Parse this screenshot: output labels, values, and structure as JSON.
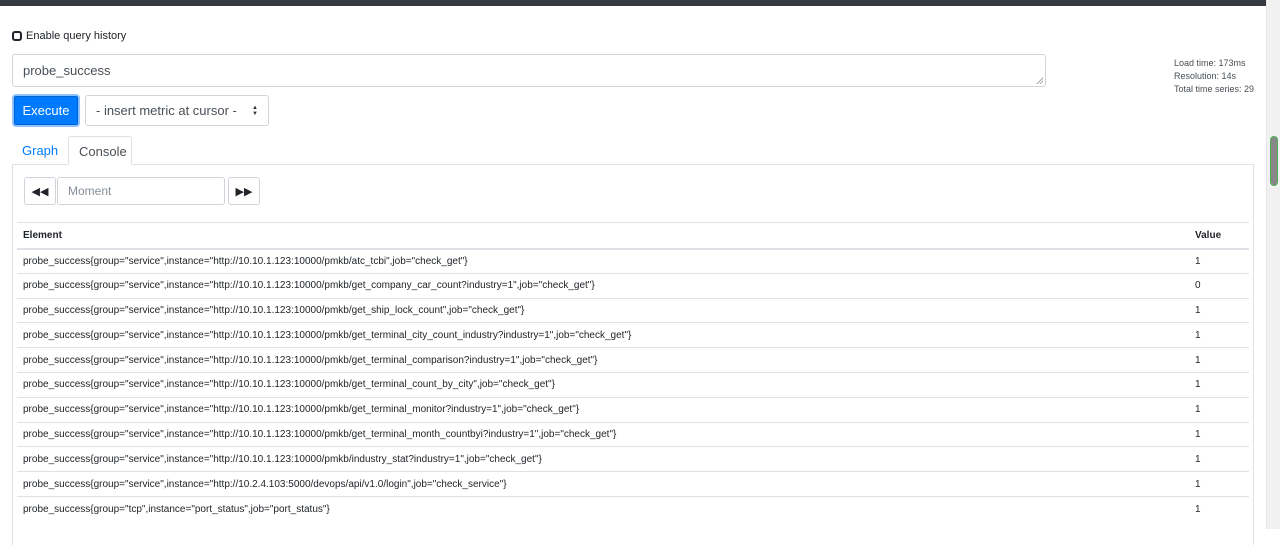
{
  "query_history": {
    "label": "Enable query history",
    "checked": false
  },
  "expression": {
    "value": "probe_success"
  },
  "stats": {
    "load_time": "Load time: 173ms",
    "resolution": "Resolution: 14s",
    "total_series": "Total time series: 29"
  },
  "execute_label": "Execute",
  "metric_select": {
    "selected": "- insert metric at cursor -"
  },
  "tabs": [
    {
      "label": "Graph",
      "active": false
    },
    {
      "label": "Console",
      "active": true
    }
  ],
  "moment": {
    "placeholder": "Moment"
  },
  "icons": {
    "back": "double-left-arrow-icon",
    "forward": "double-right-arrow-icon",
    "select": "up-down-caret-icon"
  },
  "table": {
    "headers": {
      "element": "Element",
      "value": "Value"
    },
    "rows": [
      {
        "element": "probe_success{group=\"service\",instance=\"http://10.10.1.123:10000/pmkb/atc_tcbi\",job=\"check_get\"}",
        "value": "1"
      },
      {
        "element": "probe_success{group=\"service\",instance=\"http://10.10.1.123:10000/pmkb/get_company_car_count?industry=1\",job=\"check_get\"}",
        "value": "0"
      },
      {
        "element": "probe_success{group=\"service\",instance=\"http://10.10.1.123:10000/pmkb/get_ship_lock_count\",job=\"check_get\"}",
        "value": "1"
      },
      {
        "element": "probe_success{group=\"service\",instance=\"http://10.10.1.123:10000/pmkb/get_terminal_city_count_industry?industry=1\",job=\"check_get\"}",
        "value": "1"
      },
      {
        "element": "probe_success{group=\"service\",instance=\"http://10.10.1.123:10000/pmkb/get_terminal_comparison?industry=1\",job=\"check_get\"}",
        "value": "1"
      },
      {
        "element": "probe_success{group=\"service\",instance=\"http://10.10.1.123:10000/pmkb/get_terminal_count_by_city\",job=\"check_get\"}",
        "value": "1"
      },
      {
        "element": "probe_success{group=\"service\",instance=\"http://10.10.1.123:10000/pmkb/get_terminal_monitor?industry=1\",job=\"check_get\"}",
        "value": "1"
      },
      {
        "element": "probe_success{group=\"service\",instance=\"http://10.10.1.123:10000/pmkb/get_terminal_month_countbyi?industry=1\",job=\"check_get\"}",
        "value": "1"
      },
      {
        "element": "probe_success{group=\"service\",instance=\"http://10.10.1.123:10000/pmkb/industry_stat?industry=1\",job=\"check_get\"}",
        "value": "1"
      },
      {
        "element": "probe_success{group=\"service\",instance=\"http://10.2.4.103:5000/devops/api/v1.0/login\",job=\"check_service\"}",
        "value": "1"
      },
      {
        "element": "probe_success{group=\"tcp\",instance=\"port_status\",job=\"port_status\"}",
        "value": "1"
      }
    ]
  }
}
